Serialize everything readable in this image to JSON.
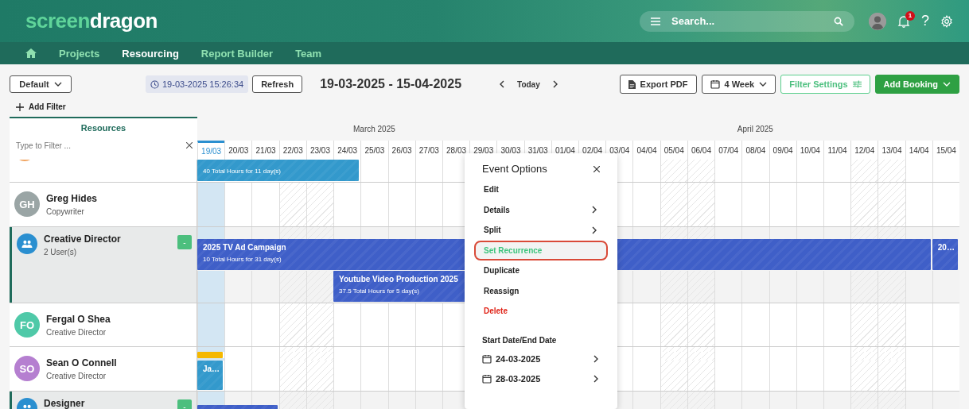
{
  "header": {
    "logo": {
      "part_1": "screen",
      "part_2": "dragon"
    },
    "search": {
      "placeholder": "Search..."
    },
    "notifications": {
      "badge": "1"
    },
    "help": "?"
  },
  "nav": {
    "items": [
      {
        "label": "Projects",
        "selected": false
      },
      {
        "label": "Resourcing",
        "selected": true
      },
      {
        "label": "Report Builder",
        "selected": false
      },
      {
        "label": "Team",
        "selected": false
      }
    ]
  },
  "toolbar": {
    "view": "Default",
    "timestamp": "19-03-2025 15:26:34",
    "refresh": "Refresh",
    "range": "19-03-2025 - 15-04-2025",
    "today": "Today",
    "export": "Export PDF",
    "period": "4 Week",
    "filter_settings": "Filter Settings",
    "add_booking": "Add Booking",
    "add_filter": "Add Filter"
  },
  "resources": {
    "title": "Resources",
    "filter_placeholder": "Type to Filter ..."
  },
  "timeline": {
    "months": [
      {
        "label": "March 2025"
      },
      {
        "label": "April 2025"
      }
    ],
    "days": [
      {
        "label": "19/03",
        "selected": true,
        "weekend": false
      },
      {
        "label": "20/03",
        "selected": false,
        "weekend": false
      },
      {
        "label": "21/03",
        "selected": false,
        "weekend": false
      },
      {
        "label": "22/03",
        "selected": false,
        "weekend": true
      },
      {
        "label": "23/03",
        "selected": false,
        "weekend": true
      },
      {
        "label": "24/03",
        "selected": false,
        "weekend": false
      },
      {
        "label": "25/03",
        "selected": false,
        "weekend": false
      },
      {
        "label": "26/03",
        "selected": false,
        "weekend": false
      },
      {
        "label": "27/03",
        "selected": false,
        "weekend": false
      },
      {
        "label": "28/03",
        "selected": false,
        "weekend": false
      },
      {
        "label": "29/03",
        "selected": false
      },
      {
        "label": "30/03",
        "selected": false
      },
      {
        "label": "31/03",
        "selected": false
      },
      {
        "label": "01/04",
        "selected": false
      },
      {
        "label": "02/04",
        "selected": false
      },
      {
        "label": "03/04",
        "selected": false,
        "weekend": false
      },
      {
        "label": "04/04",
        "selected": false,
        "weekend": false
      },
      {
        "label": "05/04",
        "selected": false,
        "weekend": true
      },
      {
        "label": "06/04",
        "selected": false,
        "weekend": true
      },
      {
        "label": "07/04",
        "selected": false,
        "weekend": false
      },
      {
        "label": "08/04",
        "selected": false,
        "weekend": false
      },
      {
        "label": "09/04",
        "selected": false,
        "weekend": false
      },
      {
        "label": "10/04",
        "selected": false,
        "weekend": false
      },
      {
        "label": "11/04",
        "selected": false,
        "weekend": false
      },
      {
        "label": "12/04",
        "selected": false,
        "weekend": true
      },
      {
        "label": "13/04",
        "selected": false,
        "weekend": true
      },
      {
        "label": "14/04",
        "selected": false,
        "weekend": false
      },
      {
        "label": "15/04",
        "selected": false,
        "weekend": false
      }
    ]
  },
  "rows": [
    {
      "kind": "partial",
      "color": "#f0a35e",
      "bookings": [
        {
          "kind": "bar",
          "subtitle": "40 Total Hours for 11 day(s)",
          "color": "#3399cc"
        }
      ]
    },
    {
      "kind": "person",
      "initials": "GH",
      "name": "Greg Hides",
      "role": "Copywriter",
      "color": "#9aa5a5",
      "bookings": []
    },
    {
      "kind": "group",
      "name": "Creative Director",
      "role": "2 User(s)",
      "collapse": "-",
      "bookings": [
        {
          "kind": "bar",
          "title": "2025 TV Ad Campaign",
          "subtitle": "10 Total Hours for 31 day(s)",
          "color": "#3f5fc8"
        },
        {
          "kind": "bar",
          "title": "Youtube Video Production 2025",
          "subtitle": "37.5 Total Hours for 5 day(s)",
          "color": "#3f5fc8"
        },
        {
          "kind": "bar",
          "title": "20…",
          "color": "#3f5fc8"
        }
      ]
    },
    {
      "kind": "person",
      "initials": "FO",
      "name": "Fergal O Shea",
      "role": "Creative Director",
      "color": "#4fc9a8",
      "bookings": []
    },
    {
      "kind": "person",
      "initials": "SO",
      "name": "Sean O Connell",
      "role": "Creative Director",
      "color": "#b57fd0",
      "bookings": [
        {
          "kind": "marker",
          "color": "#f5b800"
        },
        {
          "kind": "bar",
          "title": "Ja…",
          "color": "#3399cc"
        }
      ]
    },
    {
      "kind": "group",
      "name": "Designer",
      "collapse": "-",
      "bookings": [
        {
          "kind": "bar",
          "color": "#3f5fc8"
        }
      ]
    }
  ],
  "menu": {
    "title": "Event Options",
    "items": [
      {
        "label": "Edit",
        "kind": "action",
        "submenu": false,
        "selected": false
      },
      {
        "label": "Details",
        "kind": "action",
        "submenu": true,
        "selected": false
      },
      {
        "label": "Split",
        "kind": "action",
        "submenu": true,
        "selected": false
      },
      {
        "label": "Set Recurrence",
        "kind": "action",
        "submenu": false,
        "selected": true
      },
      {
        "label": "Duplicate",
        "kind": "action",
        "submenu": false,
        "selected": false
      },
      {
        "label": "Reassign",
        "kind": "action",
        "submenu": false,
        "selected": false
      },
      {
        "label": "Delete",
        "kind": "danger",
        "submenu": false,
        "selected": false
      }
    ],
    "dates_title": "Start Date/End Date",
    "dates": [
      {
        "label": "24-03-2025"
      },
      {
        "label": "28-03-2025"
      }
    ]
  }
}
